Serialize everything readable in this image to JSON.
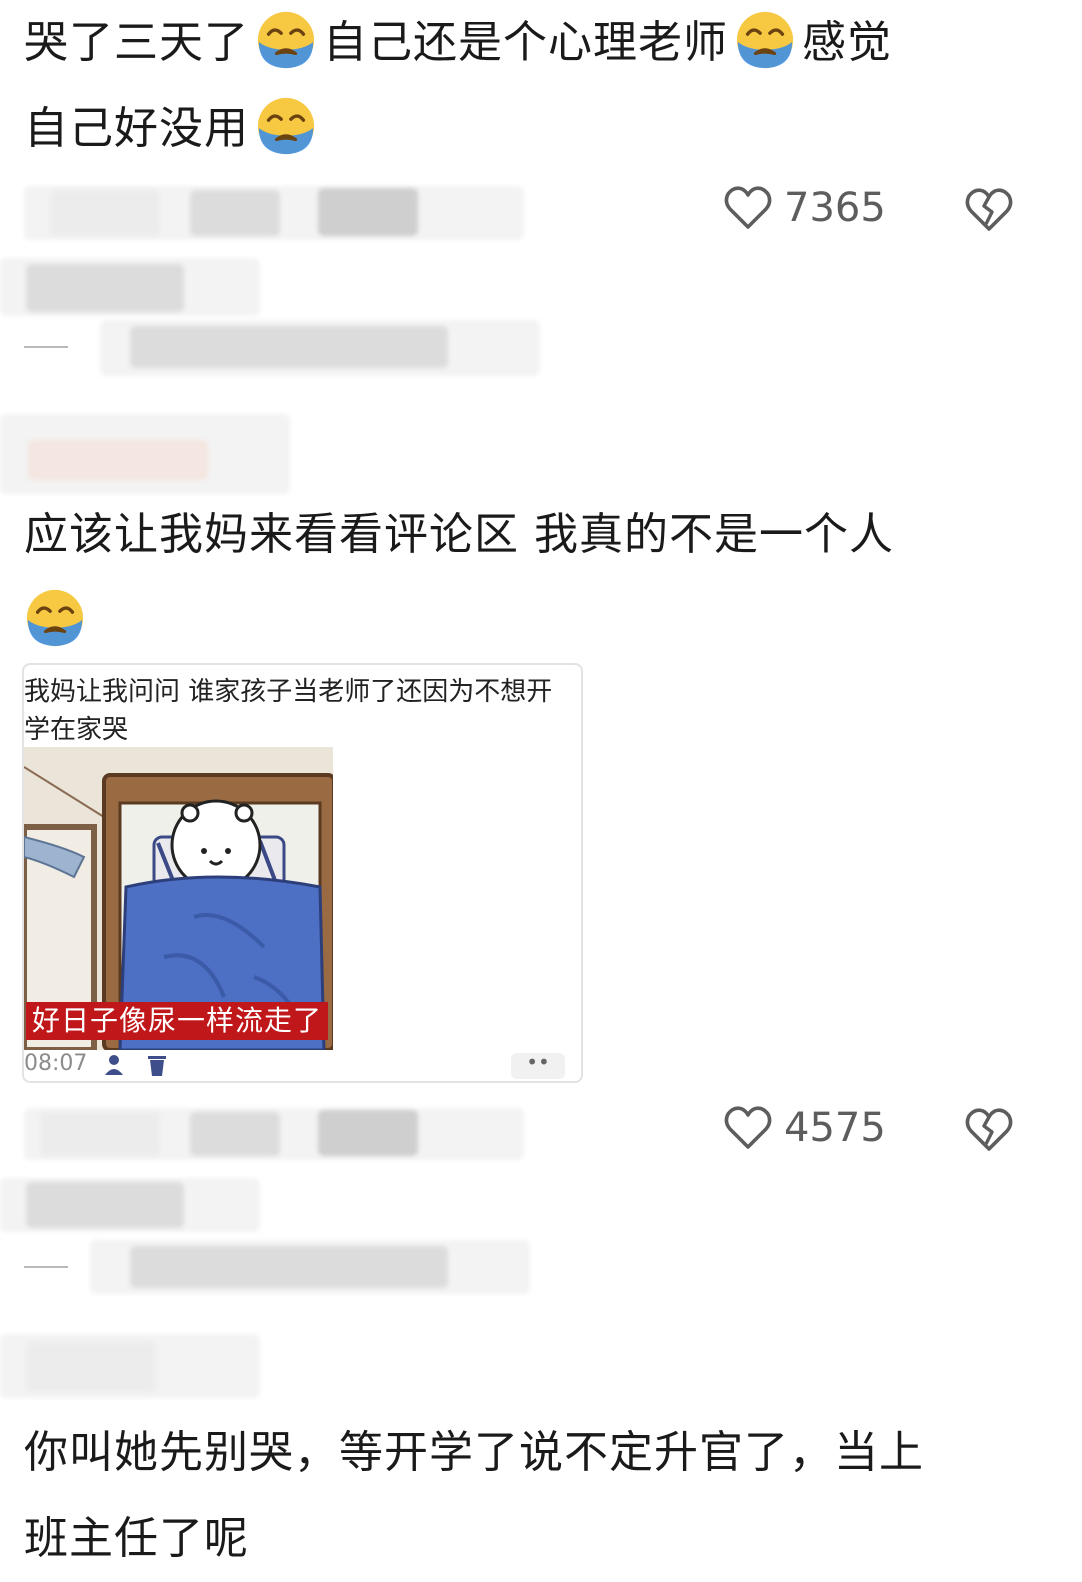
{
  "comments": [
    {
      "text_lines": [
        "哭了三天了",
        "自己还是个心理老师",
        "感觉",
        "自己好没用"
      ],
      "likes": "7365"
    },
    {
      "text_line1": "应该让我妈来看看评论区 我真的不是一个人",
      "likes": "4575",
      "embedded": {
        "text": "我妈让我问问 谁家孩子当老师了还因为不想开学在家哭",
        "caption": "好日子像尿一样流走了",
        "time": "08:07",
        "dots": "••"
      }
    },
    {
      "text_line1": "你叫她先别哭，等开学了说不定升官了，当上",
      "text_line2": "班主任了呢"
    }
  ],
  "icons": {
    "emoji": "loudly-crying-face-icon",
    "like": "heart-outline-icon",
    "dislike": "broken-heart-icon",
    "person": "person-icon",
    "delete": "trash-icon"
  },
  "colors": {
    "text": "#1a1a1a",
    "muted": "#5d5d5d",
    "caption_bg": "#c0171b",
    "emoji_face": "#f7c842",
    "emoji_tear": "#3f8fe5"
  }
}
